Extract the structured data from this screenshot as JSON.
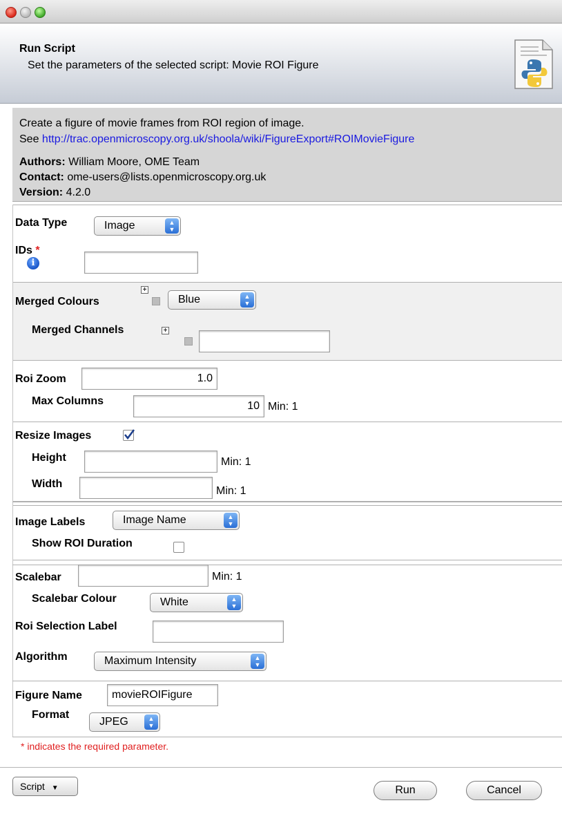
{
  "header": {
    "title": "Run Script",
    "subtitle": "Set the parameters of the selected script: Movie ROI Figure"
  },
  "info": {
    "description": "Create a figure of movie frames from ROI region of image.",
    "see_prefix": "See ",
    "see_link": "http://trac.openmicroscopy.org.uk/shoola/wiki/FigureExport#ROIMovieFigure",
    "authors_label": "Authors:",
    "authors_value": "William Moore, OME Team",
    "contact_label": "Contact:",
    "contact_value": "ome-users@lists.openmicroscopy.org.uk",
    "version_label": "Version:",
    "version_value": "4.2.0"
  },
  "form": {
    "data_type": {
      "label": "Data Type",
      "value": "Image"
    },
    "ids": {
      "label": "IDs",
      "required_mark": "*",
      "value": ""
    },
    "merged_colours": {
      "label": "Merged Colours",
      "value": "Blue"
    },
    "merged_channels": {
      "label": "Merged Channels",
      "value": ""
    },
    "roi_zoom": {
      "label": "Roi Zoom",
      "value": "1.0"
    },
    "max_columns": {
      "label": "Max Columns",
      "value": "10",
      "min": "Min: 1"
    },
    "resize_images": {
      "label": "Resize Images",
      "checked": true
    },
    "height": {
      "label": "Height",
      "value": "",
      "min": "Min: 1"
    },
    "width": {
      "label": "Width",
      "value": "",
      "min": "Min: 1"
    },
    "image_labels": {
      "label": "Image Labels",
      "value": "Image Name"
    },
    "show_roi_duration": {
      "label": "Show ROI Duration",
      "checked": false
    },
    "scalebar": {
      "label": "Scalebar",
      "value": "",
      "min": "Min: 1"
    },
    "scalebar_colour": {
      "label": "Scalebar Colour",
      "value": "White"
    },
    "roi_selection_label": {
      "label": "Roi Selection Label",
      "value": ""
    },
    "algorithm": {
      "label": "Algorithm",
      "value": "Maximum Intensity"
    },
    "figure_name": {
      "label": "Figure Name",
      "value": "movieROIFigure"
    },
    "format": {
      "label": "Format",
      "value": "JPEG"
    },
    "required_note": "* indicates the required parameter."
  },
  "footer": {
    "script_menu": "Script",
    "run": "Run",
    "cancel": "Cancel"
  },
  "icons": {
    "window_controls": [
      "close-icon",
      "minimize-icon",
      "maximize-icon"
    ],
    "header_icon": "python-script-file-icon",
    "info_icon": "info-icon"
  },
  "colors": {
    "link": "#1a1ae0",
    "required": "#e02020",
    "info_panel": "#d6d6d6",
    "select_arrow": "#2a6fd6"
  }
}
